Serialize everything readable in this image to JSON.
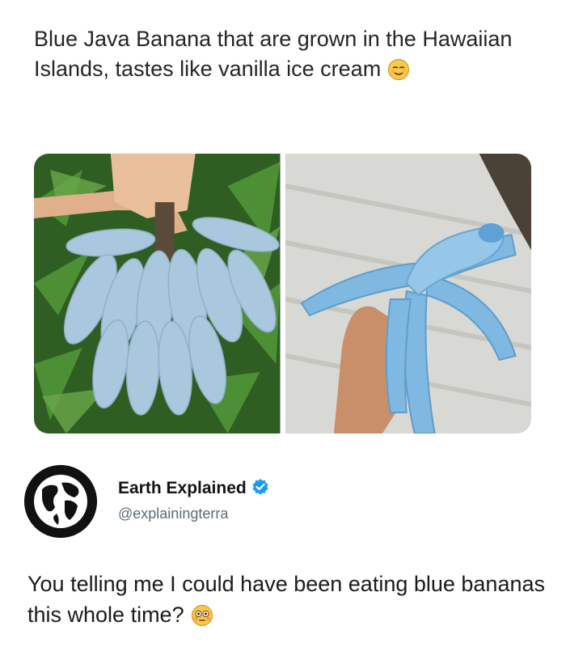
{
  "post": {
    "caption": "Blue Java Banana that are grown in the Hawaiian Islands, tastes like vanilla ice cream",
    "caption_emoji": "relieved-face-icon"
  },
  "photos": [
    {
      "subject": "banana-bunch-icon"
    },
    {
      "subject": "peeled-blue-banana-icon"
    }
  ],
  "tweet": {
    "author_name": "Earth Explained",
    "handle": "@explainingterra",
    "verified": true,
    "text": "You telling me I could have been eating blue bananas this whole time?",
    "text_emoji": "flushed-face-icon"
  },
  "colors": {
    "banana_blue": "#a9c7dd",
    "peeled_blue": "#7fb8e0",
    "foliage": "#3f7a2a",
    "verified": "#1d9bf0"
  }
}
